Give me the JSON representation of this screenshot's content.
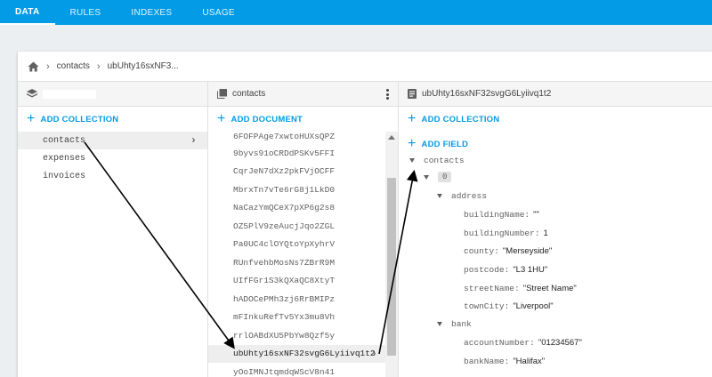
{
  "tabs": [
    {
      "label": "DATA",
      "active": true
    },
    {
      "label": "RULES",
      "active": false
    },
    {
      "label": "INDEXES",
      "active": false
    },
    {
      "label": "USAGE",
      "active": false
    }
  ],
  "breadcrumb": {
    "collection": "contacts",
    "document": "ubUhty16sxNF3..."
  },
  "col1": {
    "project_name": "",
    "add_label": "ADD COLLECTION",
    "collections": [
      "contacts",
      "expenses",
      "invoices"
    ]
  },
  "col2": {
    "header": "contacts",
    "add_label": "ADD DOCUMENT",
    "documents": [
      "6FOFPAge7xwtoHUXsQPZ",
      "9byvs91oCRDdPSKv5FFI",
      "CqrJeN7dXz2pkFVjOCFF",
      "MbrxTn7vTe6rG8j1LkD0",
      "NaCazYmQCeX7pXP6g2s8",
      "OZ5PlV9zeAucjJqo2ZGL",
      "Pa0UC4clOYQtoYpXyhrV",
      "RUnfvehbMosNs7ZBrR9M",
      "UIfFGr1S3kQXaQC8XtyT",
      "hADOCePMh3zj6RrBMIPz",
      "mFInkuRefTv5Yx3mu8Vh",
      "rrlOABdXU5PbYw8Qzf5y",
      "ubUhty16sxNF32svgG6Lyiivq1t2",
      "yOoIMNJtqmdqWScV8n41"
    ]
  },
  "col3": {
    "header": "ubUhty16sxNF32svgG6Lyiivq1t2",
    "add_collection_label": "ADD COLLECTION",
    "add_field_label": "ADD FIELD",
    "root": "contacts",
    "index": "0",
    "address_label": "address",
    "address": [
      {
        "key": "buildingName:",
        "value": "\"\""
      },
      {
        "key": "buildingNumber:",
        "value": "1"
      },
      {
        "key": "county:",
        "value": "\"Merseyside\""
      },
      {
        "key": "postcode:",
        "value": "\"L3 1HU\""
      },
      {
        "key": "streetName:",
        "value": "\"Street Name\""
      },
      {
        "key": "townCity:",
        "value": "\"Liverpool\""
      }
    ],
    "bank_label": "bank",
    "bank": [
      {
        "key": "accountNumber:",
        "value": "\"01234567\""
      },
      {
        "key": "bankName:",
        "value": "\"Halifax\""
      }
    ]
  },
  "colors": {
    "accent": "#039be5",
    "topbar": "#039be5"
  }
}
